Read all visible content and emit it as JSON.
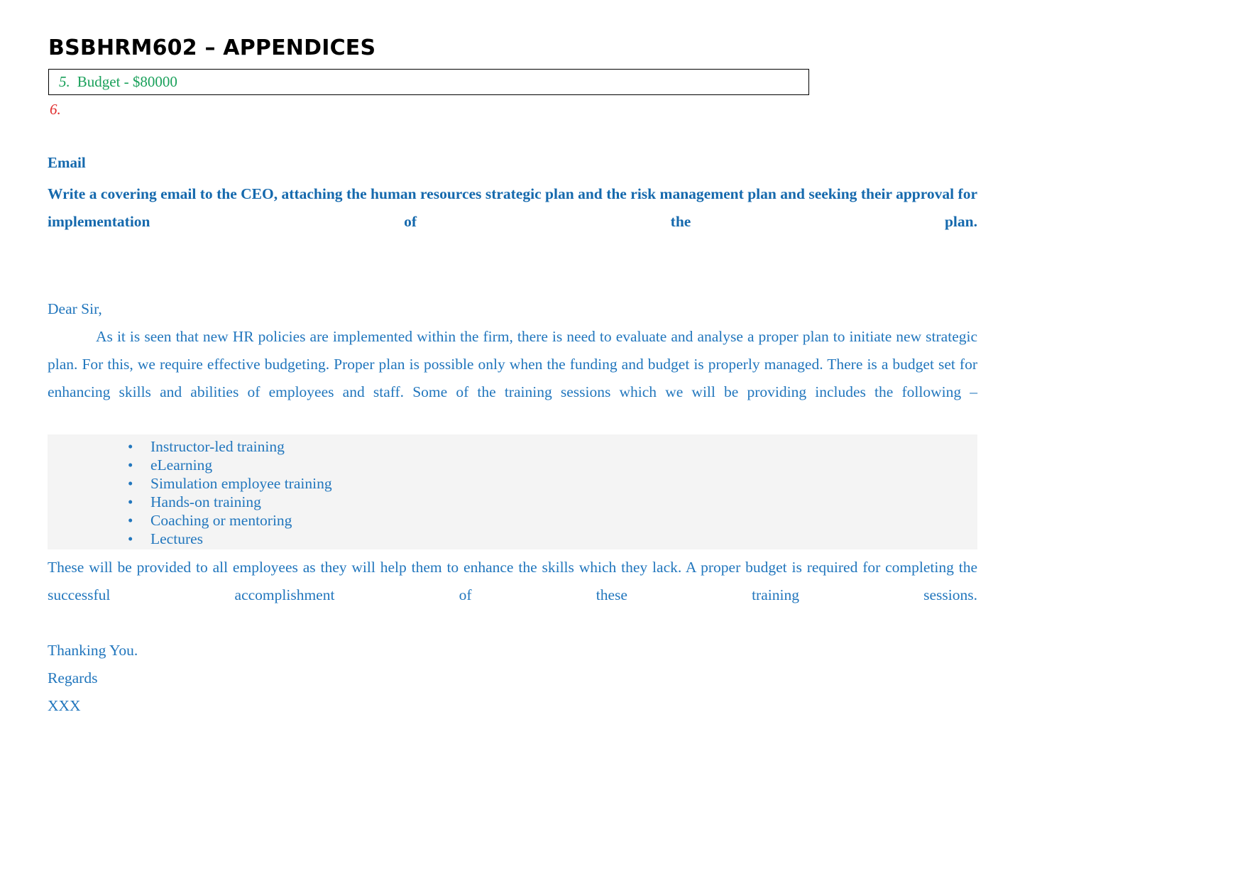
{
  "document": {
    "title": "BSBHRM602 – APPENDICES"
  },
  "numbered_items": {
    "item5": {
      "number": "5.",
      "text": "Budget - $80000",
      "number_color": "#19a05a",
      "text_color": "#19a05a"
    },
    "item6": {
      "number": "6.",
      "text": "",
      "number_color": "#e02b2b"
    }
  },
  "email_section": {
    "heading": "Email",
    "instruction": "Write a covering email to the CEO, attaching the human resources strategic plan and the risk management plan and seeking their approval for implementation of the plan.",
    "salutation": "Dear Sir,",
    "body_paragraph": "As it is seen that new HR policies are implemented within the firm, there is need to evaluate and analyse a proper plan to initiate new strategic plan. For this, we require effective budgeting. Proper plan is possible only when the funding and budget is properly managed. There is a budget set for enhancing skills and abilities of employees and staff. Some of the training sessions which we will be providing includes the following –",
    "training_list": [
      "Instructor-led training",
      "eLearning",
      "Simulation employee training",
      "Hands-on training",
      "Coaching or mentoring",
      "Lectures"
    ],
    "bullet_glyph": "•",
    "closing_paragraph": "These will be provided to all employees as they will help them to enhance the skills which they lack. A proper budget is required for completing the successful accomplishment of these training sessions.",
    "thanking": "Thanking You.",
    "regards": "Regards",
    "signature": "XXX"
  },
  "colors": {
    "heading_blue": "#1569ad",
    "body_blue": "#2176bd",
    "green": "#19a05a",
    "red": "#e02b2b",
    "list_background": "#f4f4f4",
    "page_background": "#ffffff",
    "title_black": "#000000"
  }
}
